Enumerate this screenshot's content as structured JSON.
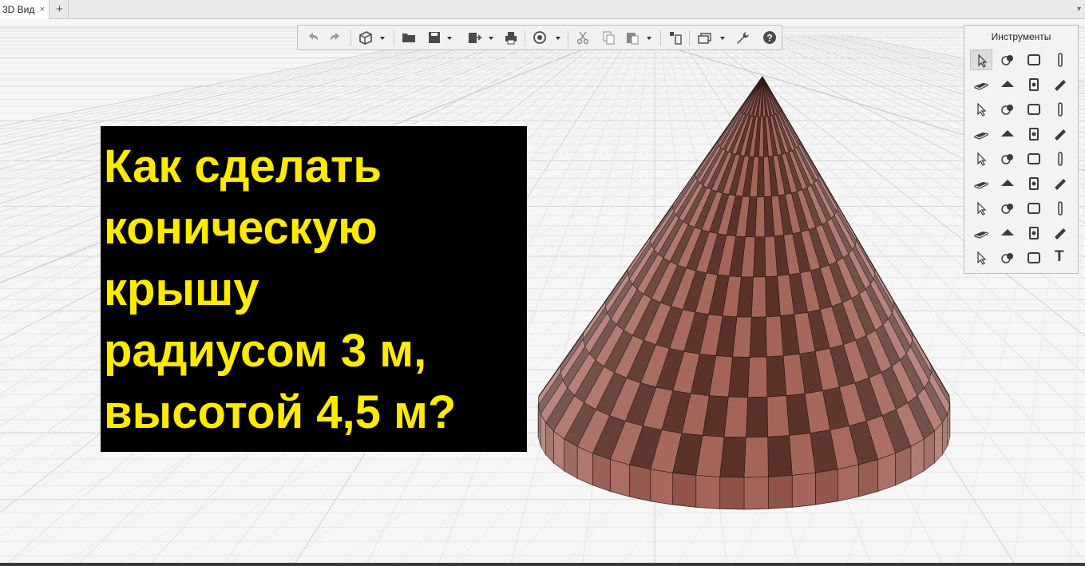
{
  "tabs": [
    {
      "label": "3D Вид",
      "close": "×"
    }
  ],
  "tab_add_label": "+",
  "tab_menu_label": "▾",
  "toolbar": {
    "buttons": [
      "undo-icon",
      "redo-icon",
      "3d-object-icon",
      "open-folder-icon",
      "save-icon",
      "export-icon",
      "print-icon",
      "rotate-view-icon",
      "cut-icon",
      "copy-icon",
      "paste-icon",
      "layout-icon",
      "layers-icon",
      "settings-wrench-icon",
      "help-icon"
    ]
  },
  "tools_panel": {
    "title": "Инструменты",
    "tools": [
      "select-arrow-icon",
      "shapes-icon",
      "room-icon",
      "column-icon",
      "wall-icon",
      "floor-slab-icon",
      "roof-icon",
      "beam-icon",
      "shingles-icon",
      "ceiling-icon",
      "door-icon",
      "window-icon",
      "fence-icon",
      "line-icon",
      "stairs-icon",
      "railing-icon",
      "plumbing-icon",
      "washer-icon",
      "kitchen-icon",
      "pipe-icon",
      "water-icon",
      "heater-icon",
      "fan-icon",
      "duct-icon",
      "gas-icon",
      "lighting-icon",
      "electric-icon",
      "cabinet-icon",
      "panel-icon",
      "gem-icon",
      "camera-icon",
      "socket-icon",
      "dimension-icon",
      "curve-icon",
      "hatch-icon",
      "text-tool-icon"
    ],
    "text_tool_label": "T"
  },
  "overlay": {
    "lines": [
      "Как сделать",
      "коническую",
      "крышу",
      "радиусом 3 м,",
      "высотой 4,5 м?"
    ]
  },
  "colors": {
    "overlay_bg": "#000000",
    "overlay_text": "#ffea00",
    "roof_dark": "#5a3028",
    "roof_light": "#a5645a"
  }
}
